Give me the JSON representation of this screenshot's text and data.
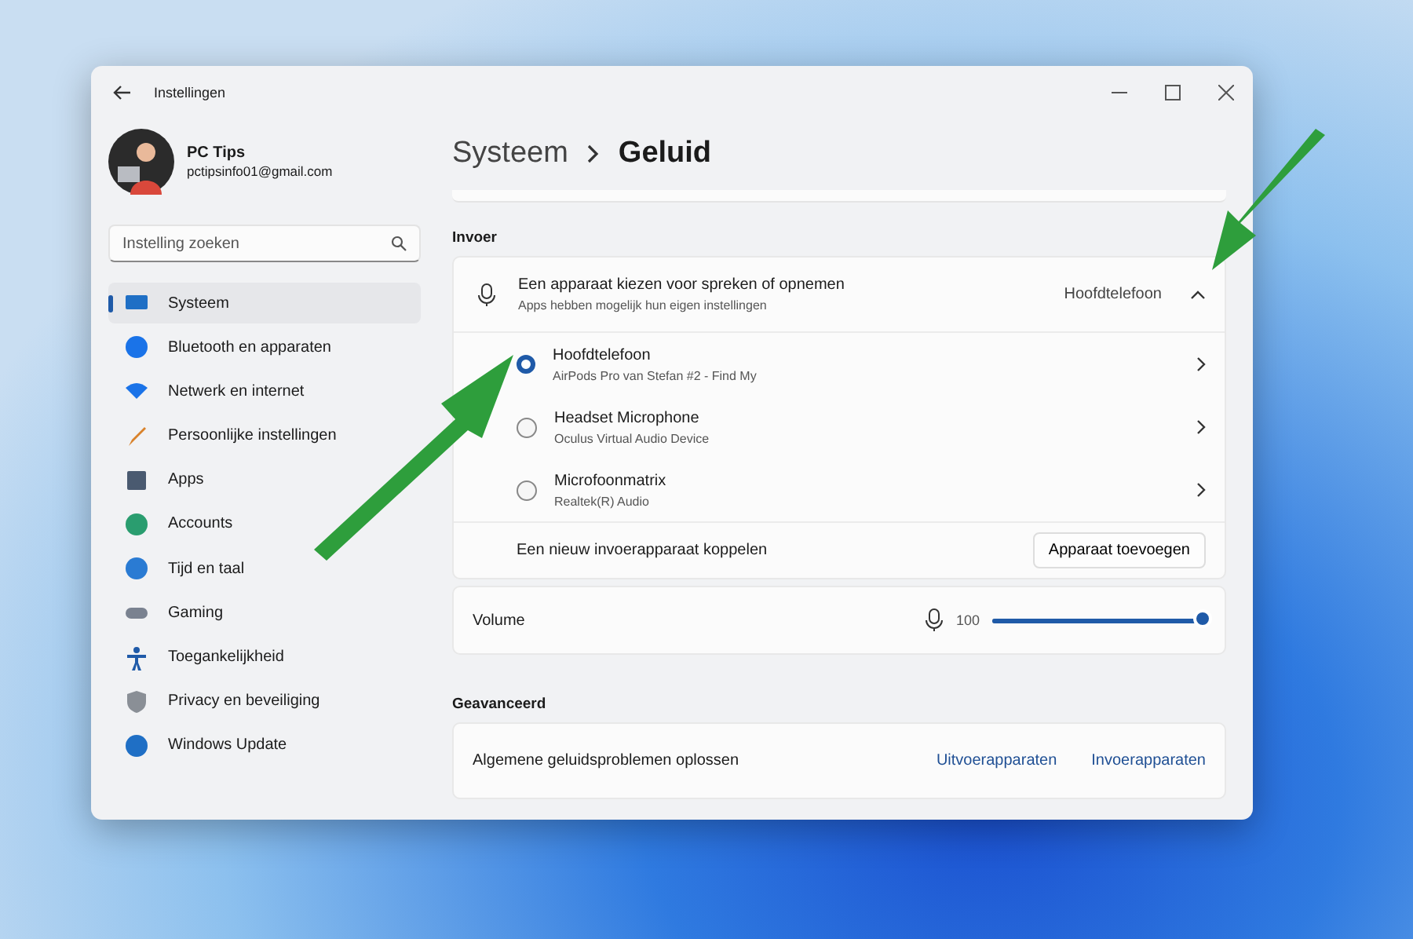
{
  "window": {
    "title": "Instellingen"
  },
  "account": {
    "name": "PC Tips",
    "email": "pctipsinfo01@gmail.com"
  },
  "search": {
    "placeholder": "Instelling zoeken"
  },
  "sidebar": {
    "items": [
      {
        "label": "Systeem",
        "selected": true
      },
      {
        "label": "Bluetooth en apparaten",
        "selected": false
      },
      {
        "label": "Netwerk en internet",
        "selected": false
      },
      {
        "label": "Persoonlijke instellingen",
        "selected": false
      },
      {
        "label": "Apps",
        "selected": false
      },
      {
        "label": "Accounts",
        "selected": false
      },
      {
        "label": "Tijd en taal",
        "selected": false
      },
      {
        "label": "Gaming",
        "selected": false
      },
      {
        "label": "Toegankelijkheid",
        "selected": false
      },
      {
        "label": "Privacy en beveiliging",
        "selected": false
      },
      {
        "label": "Windows Update",
        "selected": false
      }
    ]
  },
  "breadcrumb": [
    "Systeem",
    "Geluid"
  ],
  "input": {
    "heading": "Invoer",
    "chooser": {
      "title": "Een apparaat kiezen voor spreken of opnemen",
      "subtitle": "Apps hebben mogelijk hun eigen instellingen",
      "value": "Hoofdtelefoon",
      "expanded": true
    },
    "devices": [
      {
        "name": "Hoofdtelefoon",
        "detail": "AirPods Pro van Stefan #2 - Find My",
        "selected": true
      },
      {
        "name": "Headset Microphone",
        "detail": "Oculus Virtual Audio Device",
        "selected": false
      },
      {
        "name": "Microfoonmatrix",
        "detail": "Realtek(R) Audio",
        "selected": false
      }
    ],
    "pair": {
      "label": "Een nieuw invoerapparaat koppelen",
      "button": "Apparaat toevoegen"
    },
    "volume": {
      "label": "Volume",
      "reading": "100",
      "level": 1
    }
  },
  "advanced": {
    "heading": "Geavanceerd",
    "label": "Algemene geluidsproblemen oplossen",
    "links": [
      "Uitvoerapparaten",
      "Invoerapparaten"
    ]
  }
}
